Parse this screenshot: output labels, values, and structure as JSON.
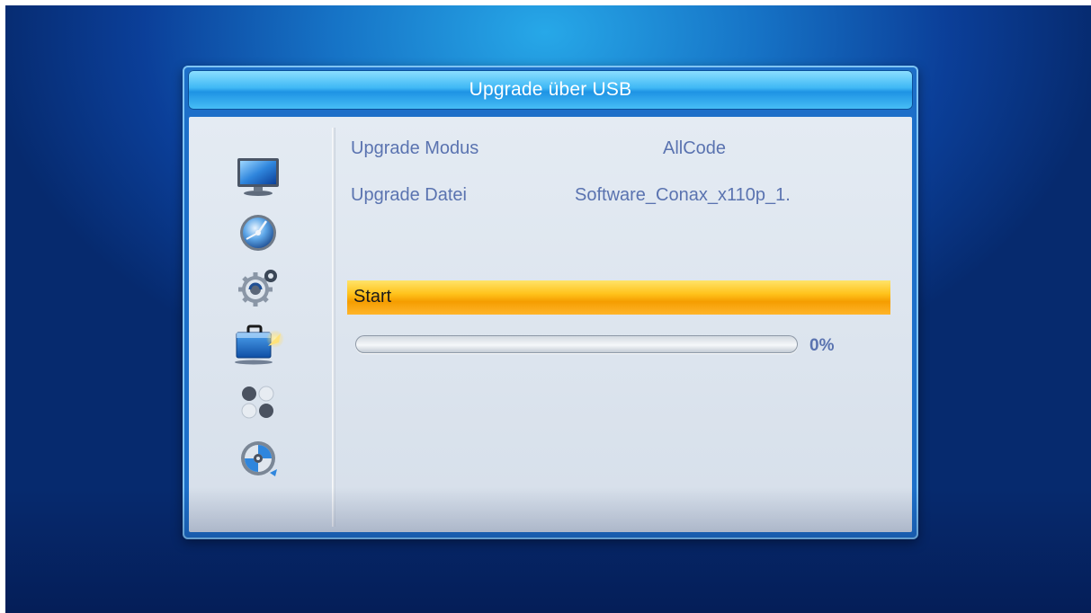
{
  "dialog": {
    "title": "Upgrade über USB"
  },
  "sidebar": {
    "items": [
      {
        "icon": "tv-monitor-icon"
      },
      {
        "icon": "satellite-dish-icon"
      },
      {
        "icon": "gears-icon"
      },
      {
        "icon": "toolbox-icon",
        "selected": true
      },
      {
        "icon": "games-balls-icon"
      },
      {
        "icon": "media-disc-icon"
      }
    ]
  },
  "settings": {
    "mode_label": "Upgrade Modus",
    "mode_value": "AllCode",
    "file_label": "Upgrade Datei",
    "file_value": "Software_Conax_x110p_1."
  },
  "start": {
    "label": "Start"
  },
  "progress": {
    "value": 0,
    "text": "0%"
  },
  "colors": {
    "highlight": "#ffc21a",
    "text": "#5a73b0",
    "title_bar": "#3fb8f5"
  }
}
